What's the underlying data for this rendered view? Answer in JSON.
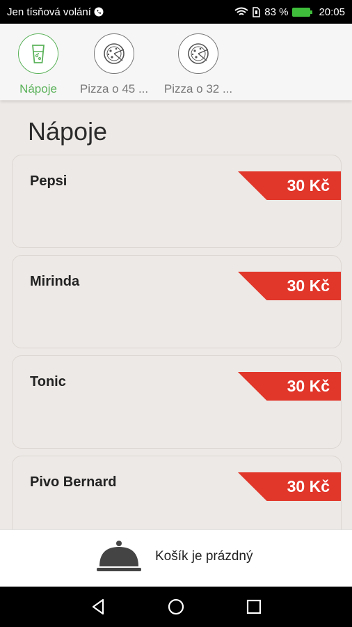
{
  "status": {
    "carrier": "Jen tísňová volání",
    "battery": "83 %",
    "time": "20:05"
  },
  "categories": [
    {
      "label": "Nápoje",
      "icon": "drink-glass-icon",
      "active": true
    },
    {
      "label": "Pizza o 45 ...",
      "icon": "pizza-icon",
      "active": false
    },
    {
      "label": "Pizza o 32 ...",
      "icon": "pizza-icon",
      "active": false
    }
  ],
  "section": {
    "title": "Nápoje"
  },
  "items": [
    {
      "name": "Pepsi",
      "price": "30 Kč"
    },
    {
      "name": "Mirinda",
      "price": "30 Kč"
    },
    {
      "name": "Tonic",
      "price": "30 Kč"
    },
    {
      "name": "Pivo Bernard",
      "price": "30 Kč"
    }
  ],
  "cart": {
    "label": "Košík je prázdný",
    "icon": "cloche-icon"
  },
  "nav": {
    "back": "back-icon",
    "home": "home-icon",
    "recents": "recents-icon"
  },
  "colors": {
    "accent_green": "#5bb25a",
    "price_red": "#e1362a",
    "background": "#ede9e6"
  }
}
